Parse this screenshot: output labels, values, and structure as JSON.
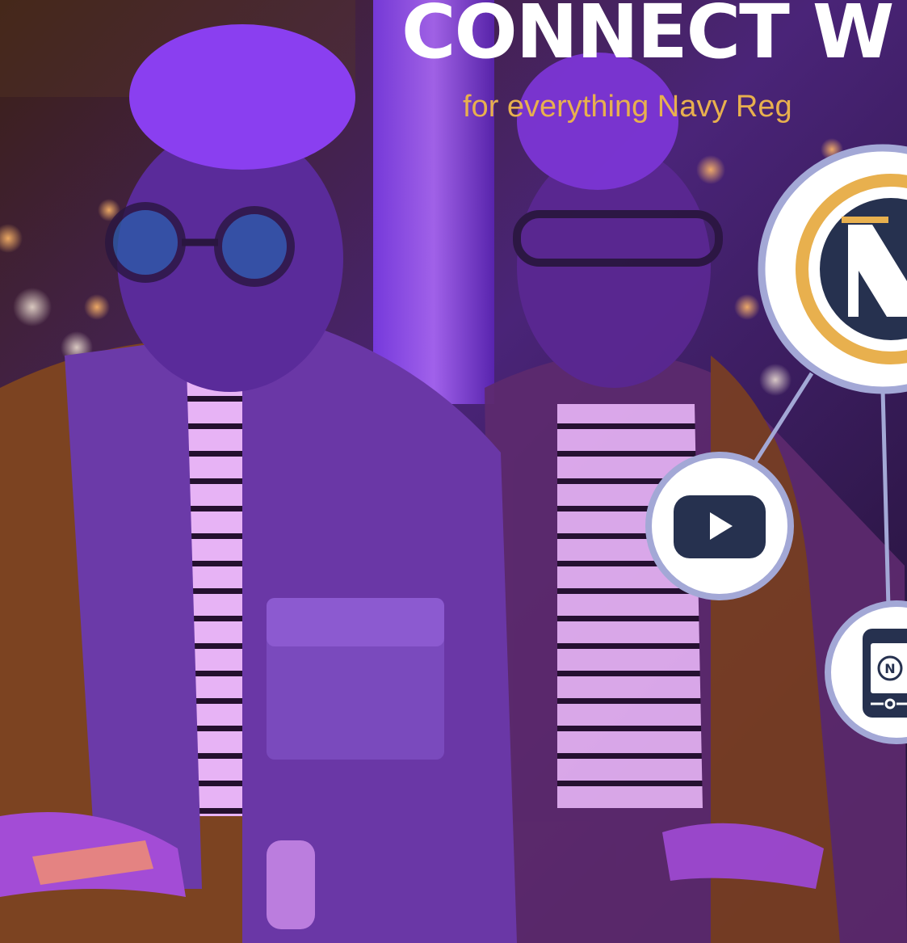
{
  "headline": "CONNECT W",
  "subhead": "for everything Navy Reg",
  "colors": {
    "accent_gold": "#e8b04e",
    "brand_navy": "#26314f",
    "ring_lavender": "#a3a8d6",
    "background_purple": "#6a2fb0"
  },
  "icons": {
    "logo": "navy-federal-n-logo-icon",
    "video": "youtube-play-icon",
    "mobile": "mobile-app-icon"
  }
}
